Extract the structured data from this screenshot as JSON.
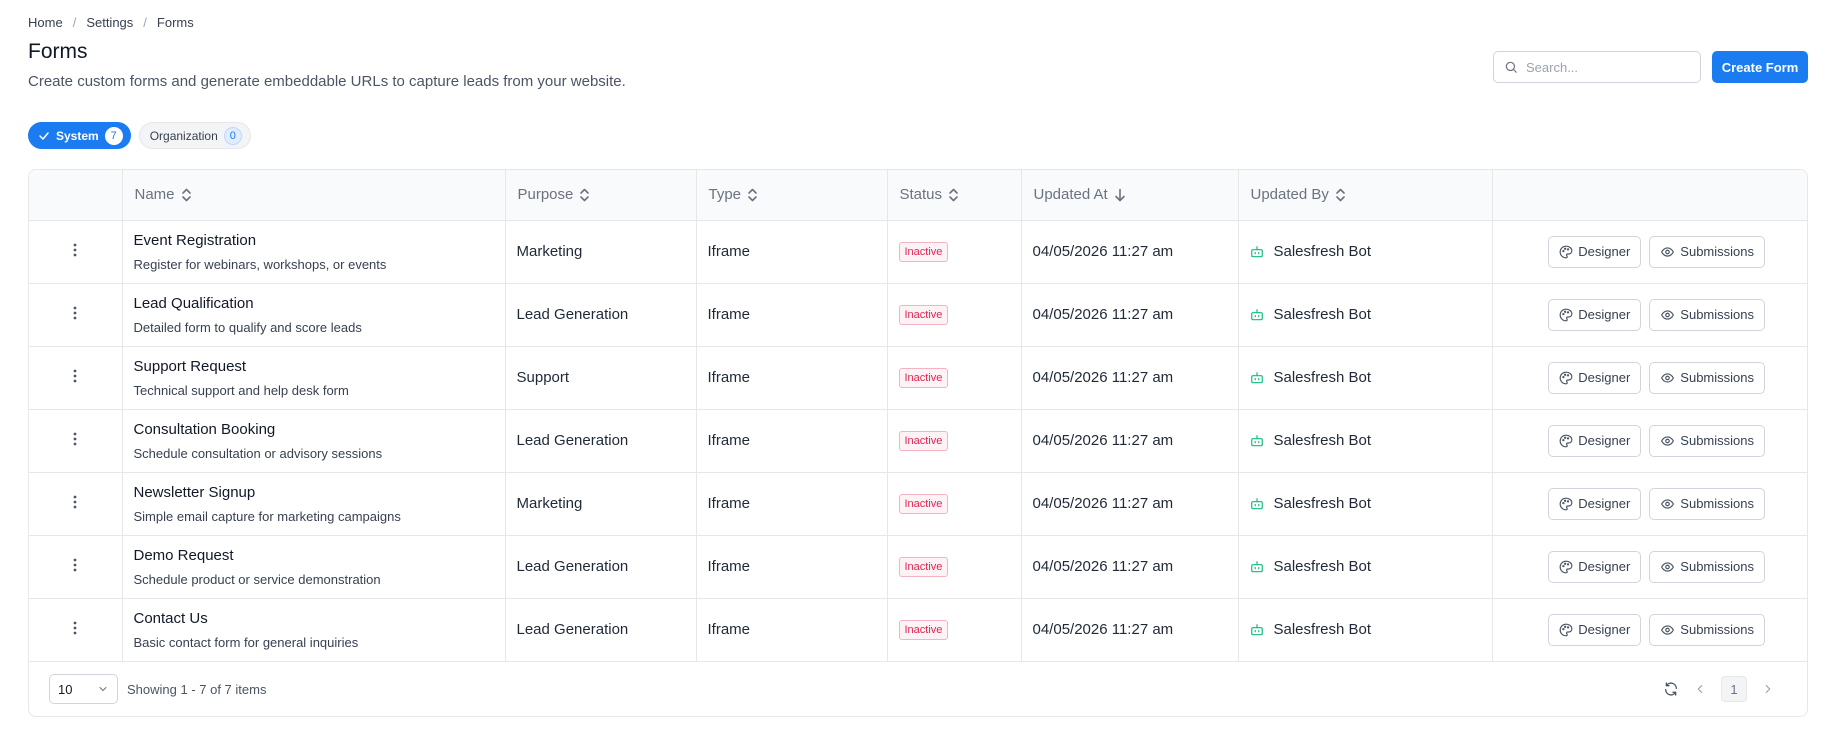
{
  "breadcrumb": [
    "Home",
    "Settings",
    "Forms"
  ],
  "page": {
    "title": "Forms",
    "subtitle": "Create custom forms and generate embeddable URLs to capture leads from your website."
  },
  "search": {
    "placeholder": "Search..."
  },
  "create_button": "Create Form",
  "tabs": [
    {
      "label": "System",
      "count": "7",
      "active": true
    },
    {
      "label": "Organization",
      "count": "0",
      "active": false
    }
  ],
  "table": {
    "columns": [
      "Name",
      "Purpose",
      "Type",
      "Status",
      "Updated At",
      "Updated By"
    ],
    "sort": {
      "column": "Updated At",
      "direction": "desc"
    },
    "action_labels": {
      "designer": "Designer",
      "submissions": "Submissions"
    },
    "rows": [
      {
        "name": "Event Registration",
        "description": "Register for webinars, workshops, or events",
        "purpose": "Marketing",
        "type": "Iframe",
        "status": "Inactive",
        "updated_at": "04/05/2026 11:27 am",
        "updated_by": "Salesfresh Bot"
      },
      {
        "name": "Lead Qualification",
        "description": "Detailed form to qualify and score leads",
        "purpose": "Lead Generation",
        "type": "Iframe",
        "status": "Inactive",
        "updated_at": "04/05/2026 11:27 am",
        "updated_by": "Salesfresh Bot"
      },
      {
        "name": "Support Request",
        "description": "Technical support and help desk form",
        "purpose": "Support",
        "type": "Iframe",
        "status": "Inactive",
        "updated_at": "04/05/2026 11:27 am",
        "updated_by": "Salesfresh Bot"
      },
      {
        "name": "Consultation Booking",
        "description": "Schedule consultation or advisory sessions",
        "purpose": "Lead Generation",
        "type": "Iframe",
        "status": "Inactive",
        "updated_at": "04/05/2026 11:27 am",
        "updated_by": "Salesfresh Bot"
      },
      {
        "name": "Newsletter Signup",
        "description": "Simple email capture for marketing campaigns",
        "purpose": "Marketing",
        "type": "Iframe",
        "status": "Inactive",
        "updated_at": "04/05/2026 11:27 am",
        "updated_by": "Salesfresh Bot"
      },
      {
        "name": "Demo Request",
        "description": "Schedule product or service demonstration",
        "purpose": "Lead Generation",
        "type": "Iframe",
        "status": "Inactive",
        "updated_at": "04/05/2026 11:27 am",
        "updated_by": "Salesfresh Bot"
      },
      {
        "name": "Contact Us",
        "description": "Basic contact form for general inquiries",
        "purpose": "Lead Generation",
        "type": "Iframe",
        "status": "Inactive",
        "updated_at": "04/05/2026 11:27 am",
        "updated_by": "Salesfresh Bot"
      }
    ]
  },
  "footer": {
    "page_size": "10",
    "showing": "Showing 1 - 7 of 7 items",
    "current_page": "1"
  },
  "icons": {
    "search": "search-icon",
    "check": "check-icon",
    "sort": "sort-icon",
    "sort_desc": "arrow-down-icon",
    "kebab": "more-vertical-icon",
    "bot": "bot-icon",
    "designer": "palette-icon",
    "submissions": "eye-icon",
    "refresh": "refresh-icon",
    "prev": "chevron-left-icon",
    "next": "chevron-right-icon",
    "dropdown": "chevron-down-icon"
  },
  "colors": {
    "primary": "#1a7cf0",
    "status_inactive": "#dc2650",
    "bot_icon": "#10b981"
  }
}
